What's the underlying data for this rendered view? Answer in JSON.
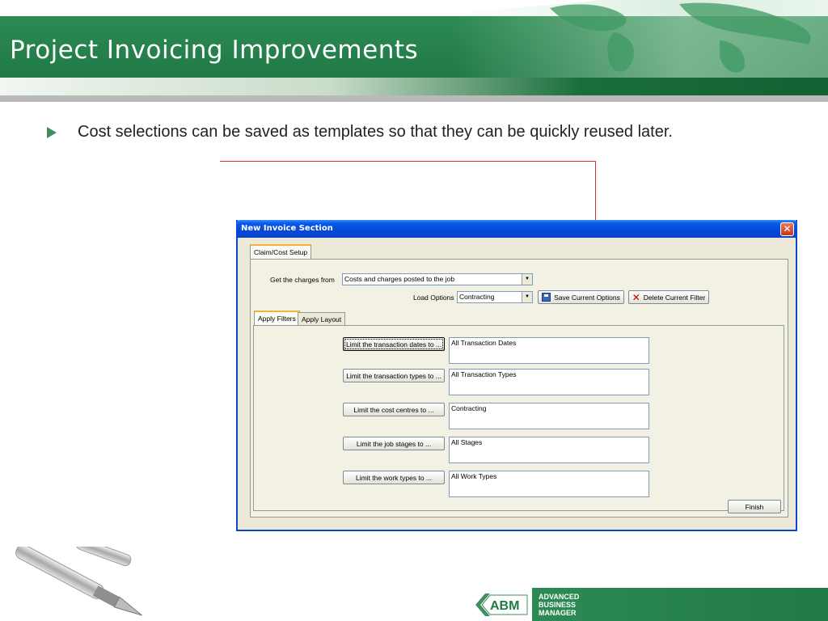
{
  "slide": {
    "title": "Project Invoicing Improvements",
    "bullet": "Cost selections can be saved as templates so that they can be quickly reused later."
  },
  "dialog": {
    "title": "New Invoice Section",
    "close_glyph": "✕",
    "tab_main": "Claim/Cost Setup",
    "charges_label": "Get the charges from",
    "charges_value": "Costs and charges posted to the job",
    "load_options_label": "Load Options",
    "load_options_value": "Contracting",
    "save_button": "Save Current Options",
    "delete_button": "Delete Current Filter",
    "subtabs": [
      "Apply Filters",
      "Apply Layout"
    ],
    "filters": [
      {
        "button": "Limit the transaction dates to ...",
        "value": "All Transaction Dates"
      },
      {
        "button": "Limit the transaction types to ...",
        "value": "All Transaction Types"
      },
      {
        "button": "Limit the cost centres to ...",
        "value": "Contracting"
      },
      {
        "button": "Limit the job stages to ...",
        "value": "All Stages"
      },
      {
        "button": "Limit the work types to ...",
        "value": "All Work Types"
      }
    ],
    "finish_button": "Finish"
  },
  "footer": {
    "logo": "ABM",
    "line1": "ADVANCED",
    "line2": "BUSINESS",
    "line3": "MANAGER"
  },
  "colors": {
    "header_green": "#1f7a46",
    "callout_red": "#e03030",
    "xp_blue": "#0a48d0"
  }
}
